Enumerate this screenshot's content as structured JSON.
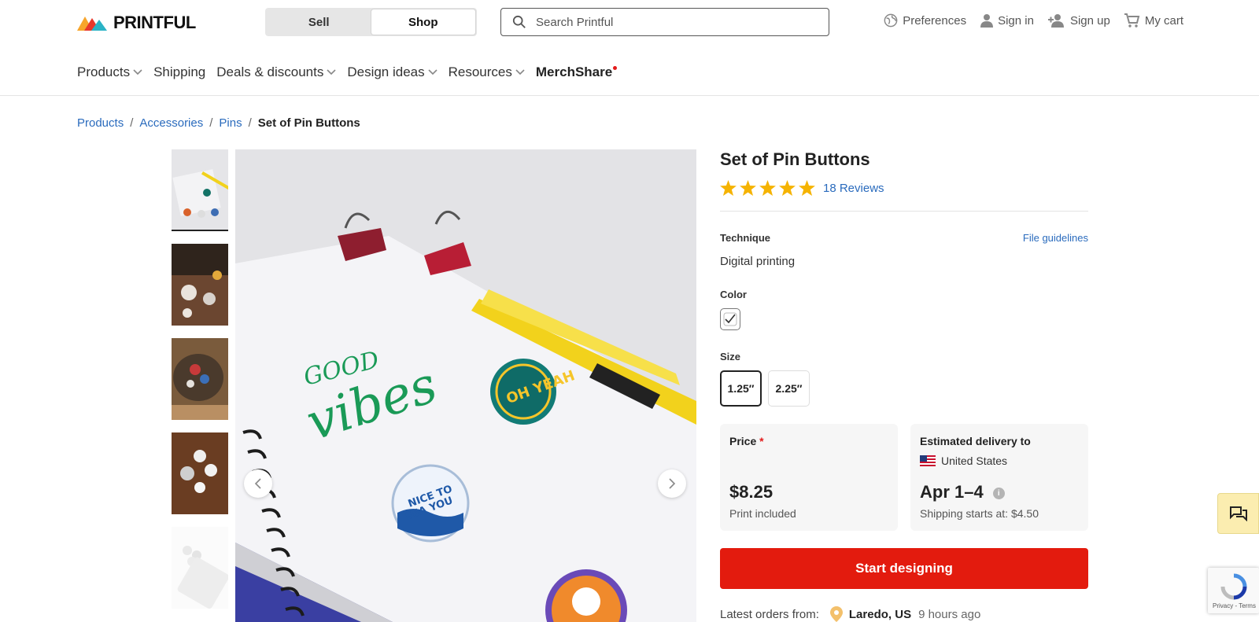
{
  "header": {
    "logo_text": "PRINTFUL",
    "mode_toggle": {
      "sell": "Sell",
      "shop": "Shop",
      "active": "Shop"
    },
    "search": {
      "placeholder": "Search Printful",
      "value": ""
    },
    "links": {
      "preferences": "Preferences",
      "sign_in": "Sign in",
      "sign_up": "Sign up",
      "cart": "My cart"
    }
  },
  "nav": {
    "items": [
      {
        "label": "Products",
        "dropdown": true
      },
      {
        "label": "Shipping",
        "dropdown": false
      },
      {
        "label": "Deals & discounts",
        "dropdown": true
      },
      {
        "label": "Design ideas",
        "dropdown": true
      },
      {
        "label": "Resources",
        "dropdown": true
      },
      {
        "label": "MerchShare",
        "dropdown": false
      }
    ]
  },
  "breadcrumb": {
    "items": [
      "Products",
      "Accessories",
      "Pins"
    ],
    "current": "Set of Pin Buttons"
  },
  "product": {
    "title": "Set of Pin Buttons",
    "rating_stars": 5,
    "reviews": "18 Reviews",
    "technique_label": "Technique",
    "file_guidelines": "File guidelines",
    "technique_value": "Digital printing",
    "color_label": "Color",
    "size_label": "Size",
    "sizes": [
      "1.25″",
      "2.25″"
    ],
    "selected_size": "1.25″",
    "price_label": "Price",
    "price_required_mark": "*",
    "price": "$8.25",
    "price_note": "Print included",
    "delivery_label": "Estimated delivery to",
    "delivery_country": "United States",
    "delivery_dates": "Apr 1–4",
    "shipping_note": "Shipping starts at: $4.50",
    "cta": "Start designing",
    "latest_label": "Latest orders from:",
    "latest_place": "Laredo, US",
    "latest_time": "9 hours ago"
  },
  "widgets": {
    "recaptcha_text": "Privacy - Terms"
  },
  "colors": {
    "accent_red": "#e31b0e",
    "link_blue": "#2a6bbd",
    "star_yellow": "#f5b301"
  }
}
